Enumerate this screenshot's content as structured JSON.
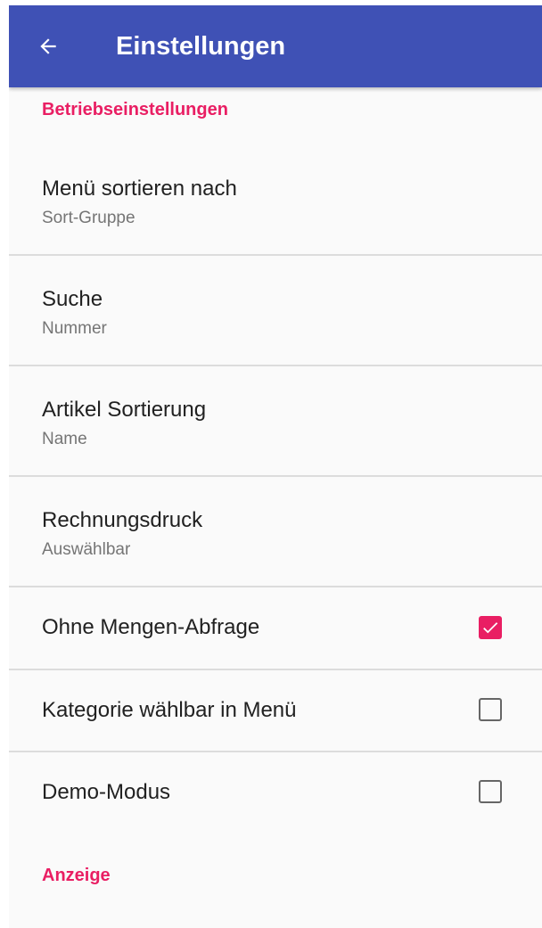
{
  "appbar": {
    "title": "Einstellungen",
    "back_icon": "arrow-back-icon",
    "color": "#3f51b5"
  },
  "accent_color": "#e91e63",
  "sections": [
    {
      "header": "Betriebseinstellungen",
      "items": [
        {
          "title": "Menü sortieren nach",
          "summary": "Sort-Gruppe"
        },
        {
          "title": "Suche",
          "summary": "Nummer"
        },
        {
          "title": "Artikel Sortierung",
          "summary": "Name"
        },
        {
          "title": "Rechnungsdruck",
          "summary": "Auswählbar"
        },
        {
          "title": "Ohne Mengen-Abfrage",
          "checked": true
        },
        {
          "title": "Kategorie wählbar in Menü",
          "checked": false
        },
        {
          "title": "Demo-Modus",
          "checked": false
        }
      ]
    },
    {
      "header": "Anzeige"
    }
  ]
}
